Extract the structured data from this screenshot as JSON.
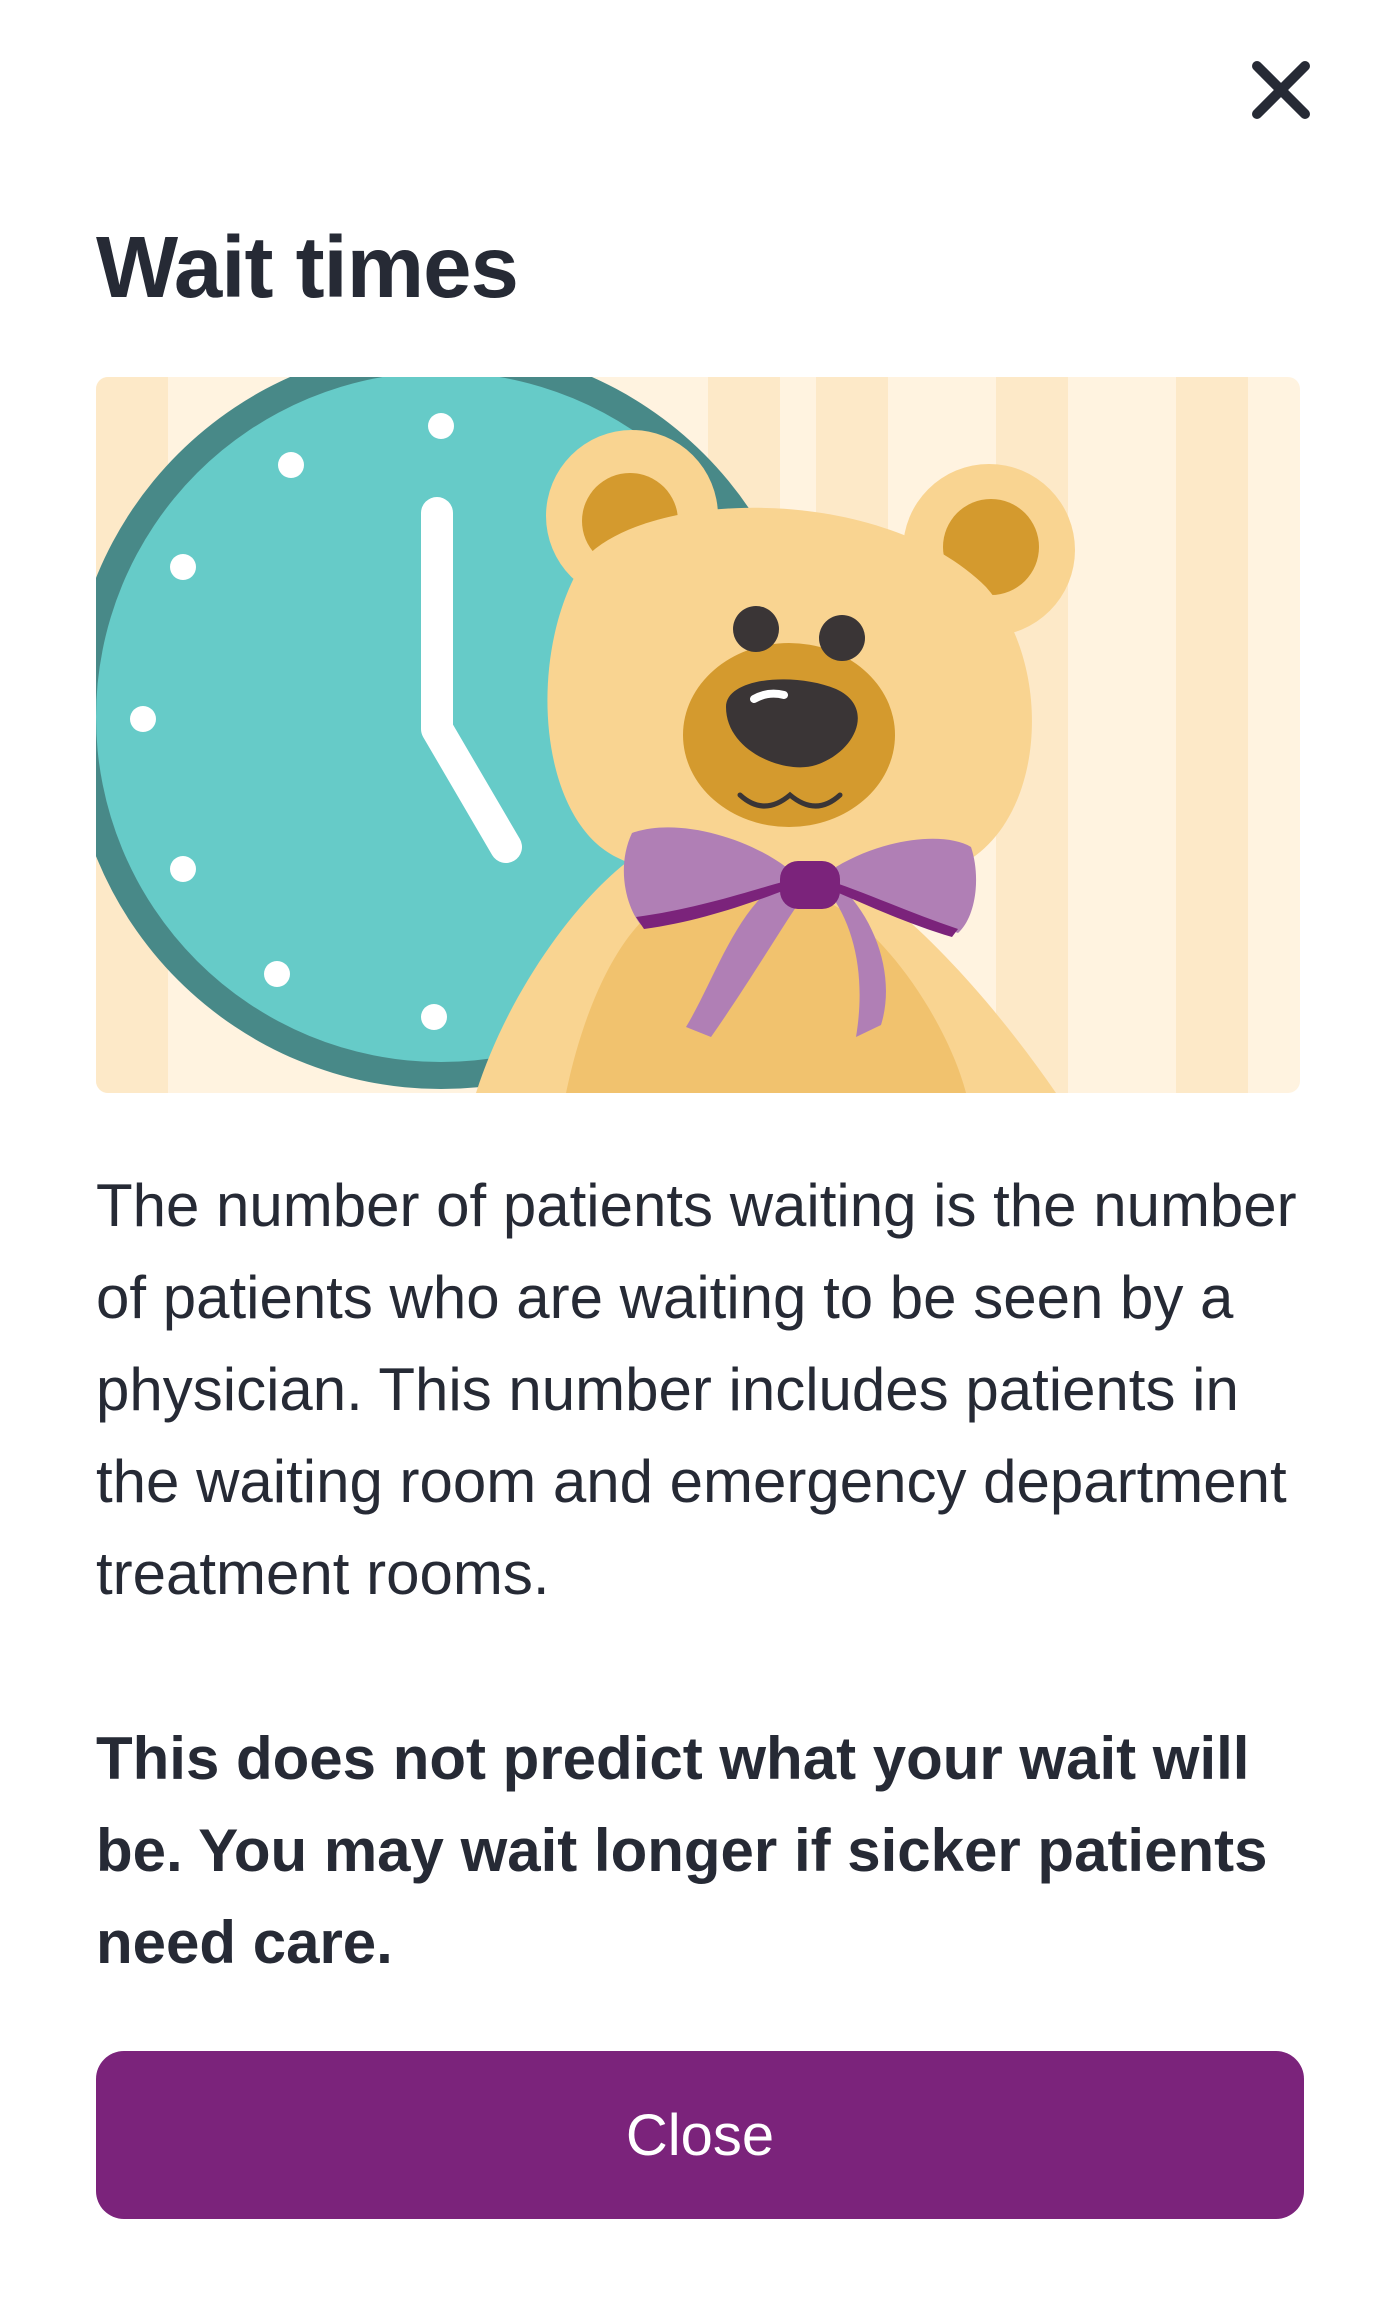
{
  "modal": {
    "close_icon": "close-icon",
    "title": "Wait times",
    "illustration_icon": "clock-and-teddy-bear-illustration",
    "description": "The number of patients waiting is the number of patients who are waiting to be seen by a physician. This number includes patients in the waiting room and emergency department treatment rooms.",
    "warning": "This does not predict what your wait will be. You may wait longer if sicker patients need care.",
    "close_button_label": "Close"
  },
  "colors": {
    "text": "#262a35",
    "button": "#7b237b",
    "button_text": "#ffffff",
    "clock_face": "#66cbc8",
    "clock_rim": "#488988",
    "bear": "#f9d491",
    "bear_accent": "#d49a2e",
    "bow": "#b07fb5",
    "bow_knot": "#7b237b",
    "stripe_light": "#fff3e0",
    "stripe_dark": "#fde9c8"
  }
}
